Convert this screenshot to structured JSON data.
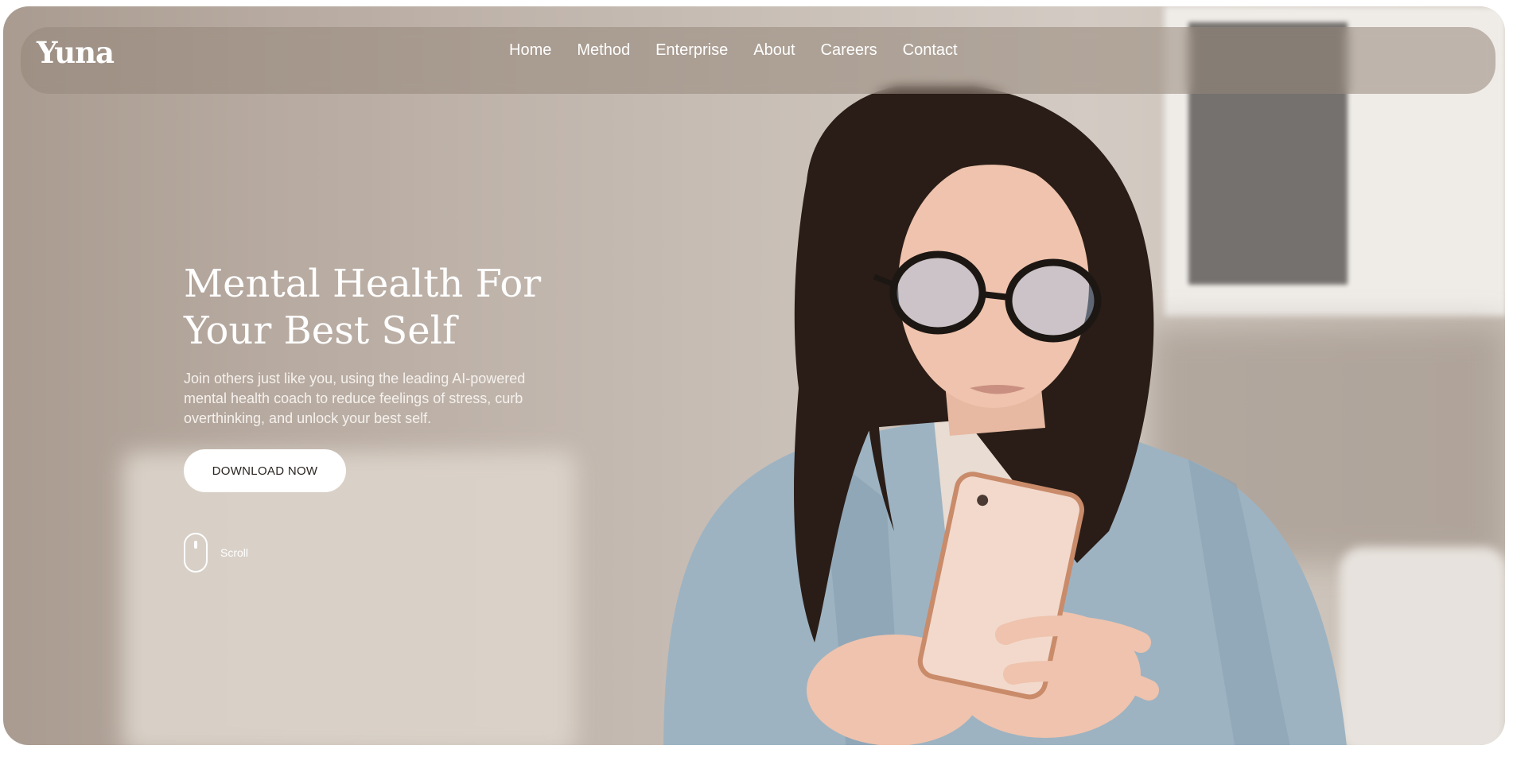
{
  "brand": {
    "logo_text": "Yuna"
  },
  "nav": {
    "items": [
      {
        "label": "Home"
      },
      {
        "label": "Method"
      },
      {
        "label": "Enterprise"
      },
      {
        "label": "About"
      },
      {
        "label": "Careers"
      },
      {
        "label": "Contact"
      }
    ]
  },
  "hero": {
    "title_line1": "Mental Health For",
    "title_line2": "Your Best Self",
    "description": "Join others just like you, using the leading AI-powered mental health coach to reduce feelings of stress, curb overthinking, and unlock your best self.",
    "cta_label": "DOWNLOAD NOW",
    "scroll_label": "Scroll",
    "scroll_icon": "mouse-icon"
  },
  "colors": {
    "overlay": "#96867a",
    "text": "#ffffff",
    "button_bg": "#ffffff",
    "button_text": "#2a2420"
  }
}
